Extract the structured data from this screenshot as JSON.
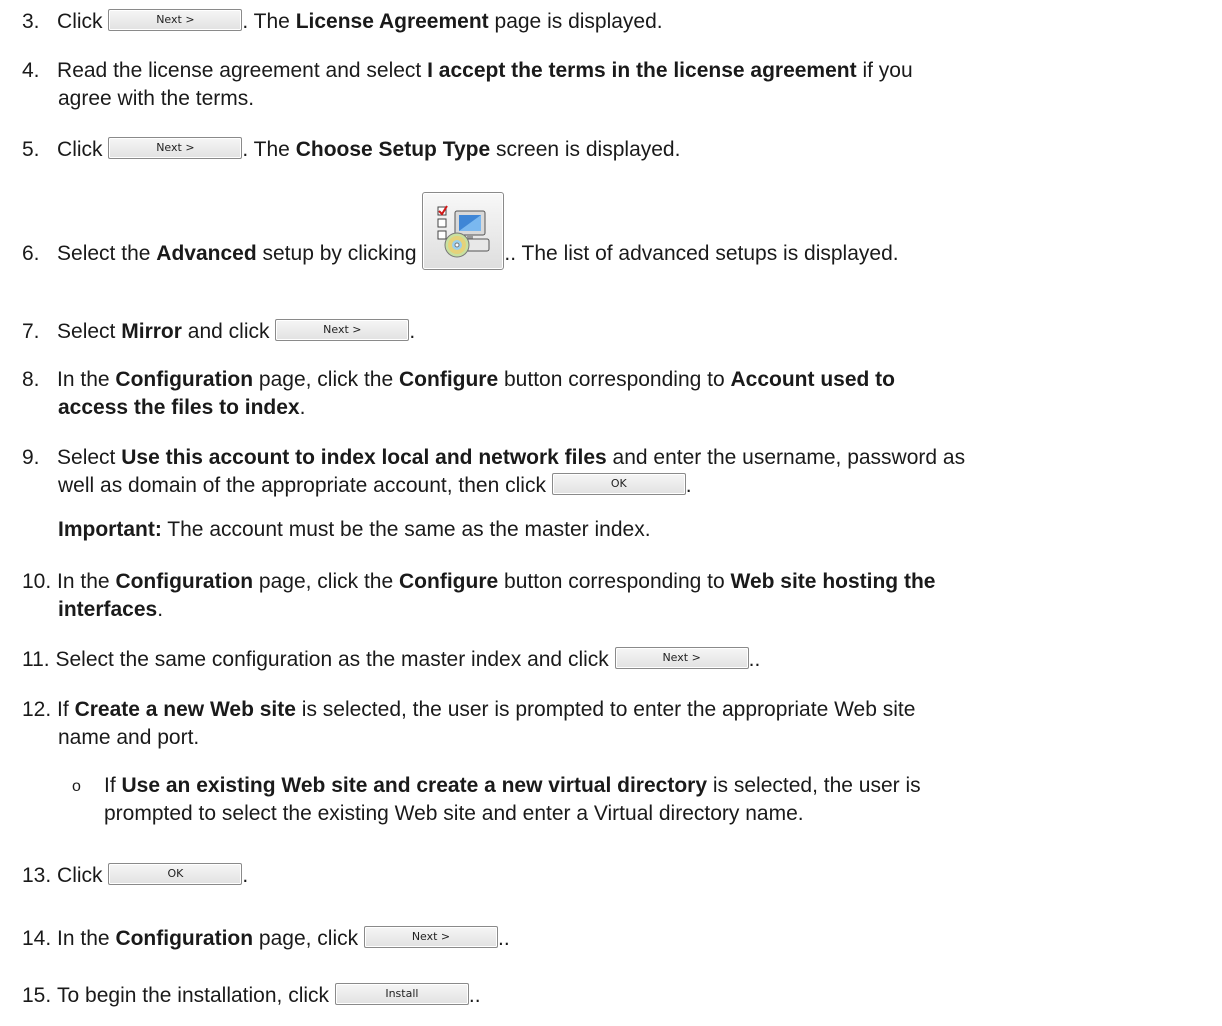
{
  "buttons": {
    "next": "Next >",
    "ok": "OK",
    "install": "Install"
  },
  "steps": {
    "s3": {
      "num": "3.",
      "pre": "Click",
      "post": ". The",
      "bold": "License Agreement",
      "tail": "page is displayed."
    },
    "s4": {
      "num": "4.",
      "pre": "Read the license agreement and select",
      "bold": "I accept the terms in the license agreement",
      "tail": "if you",
      "line2": "agree with the terms."
    },
    "s5": {
      "num": "5.",
      "pre": "Click",
      "post": ". The",
      "bold": "Choose Setup Type",
      "tail": "screen is displayed."
    },
    "s6": {
      "num": "6.",
      "pre": "Select the",
      "bold": "Advanced",
      "mid": "setup by clicking",
      "tail": ".. The list of advanced setups is displayed."
    },
    "s7": {
      "num": "7.",
      "pre": "Select",
      "bold": "Mirror",
      "mid": "and click",
      "tail": "."
    },
    "s8": {
      "num": "8.",
      "pre": "In the",
      "bold1": "Configuration",
      "mid": "page, click the",
      "bold2": "Configure",
      "mid2": "button corresponding to",
      "bold3": "Account used to",
      "line2bold": "access the files to index",
      "line2tail": "."
    },
    "s9": {
      "num": "9.",
      "pre": "Select",
      "bold": "Use this account to index local and network files",
      "tail": "and enter the username, password as",
      "line2": "well as domain of the appropriate account, then click",
      "end": "."
    },
    "important": {
      "label": "Important:",
      "text": "The account must be the same as the master index."
    },
    "s10": {
      "num": "10.",
      "pre": "In the",
      "bold1": "Configuration",
      "mid": "page, click the",
      "bold2": "Configure",
      "mid2": "button corresponding to",
      "bold3": "Web site hosting the",
      "line2bold": "interfaces",
      "line2tail": "."
    },
    "s11": {
      "num": "11.",
      "pre": "Select the same configuration as the master index and click",
      "end": ".."
    },
    "s12": {
      "num": "12.",
      "pre": "If",
      "bold": "Create a new Web site",
      "tail": "is selected, the user is prompted to enter the appropriate Web site",
      "line2": "name and port."
    },
    "sub": {
      "bullet": "o",
      "pre": "If",
      "bold": "Use an existing Web site and create a new virtual directory",
      "tail": "is selected, the user is",
      "line2": "prompted to select the existing Web site and enter a Virtual directory name."
    },
    "s13": {
      "num": "13.",
      "pre": "Click",
      "end": "."
    },
    "s14": {
      "num": "14.",
      "pre": "In the",
      "bold": "Configuration",
      "mid": "page, click",
      "end": ".."
    },
    "s15": {
      "num": "15.",
      "pre": "To begin the installation, click",
      "end": ".."
    }
  },
  "icons": {
    "advanced_setup": "advanced-setup-icon"
  }
}
